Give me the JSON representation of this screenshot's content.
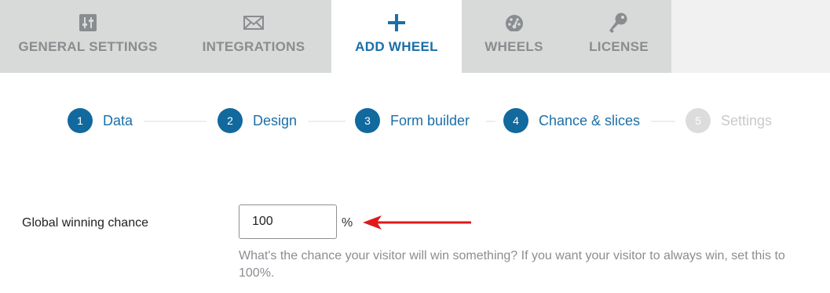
{
  "tabs": [
    {
      "label": "GENERAL SETTINGS",
      "icon": "sliders-icon",
      "active": false
    },
    {
      "label": "INTEGRATIONS",
      "icon": "envelope-icon",
      "active": false
    },
    {
      "label": "ADD WHEEL",
      "icon": "plus-icon",
      "active": true
    },
    {
      "label": "WHEELS",
      "icon": "dashboard-icon",
      "active": false
    },
    {
      "label": "LICENSE",
      "icon": "key-icon",
      "active": false
    }
  ],
  "steps": [
    {
      "number": "1",
      "label": "Data",
      "enabled": true
    },
    {
      "number": "2",
      "label": "Design",
      "enabled": true
    },
    {
      "number": "3",
      "label": "Form builder",
      "enabled": true
    },
    {
      "number": "4",
      "label": "Chance & slices",
      "enabled": true
    },
    {
      "number": "5",
      "label": "Settings",
      "enabled": false
    }
  ],
  "form": {
    "winning_chance_label": "Global winning chance",
    "winning_chance_value": "100",
    "unit": "%",
    "help_text": "What's the chance your visitor will win something? If you want your visitor to always win, set this to 100%."
  },
  "colors": {
    "accent": "#1a6fa8",
    "step_circle": "#11699e",
    "tab_inactive": "#d8d9d9",
    "arrow": "#e0191b"
  }
}
